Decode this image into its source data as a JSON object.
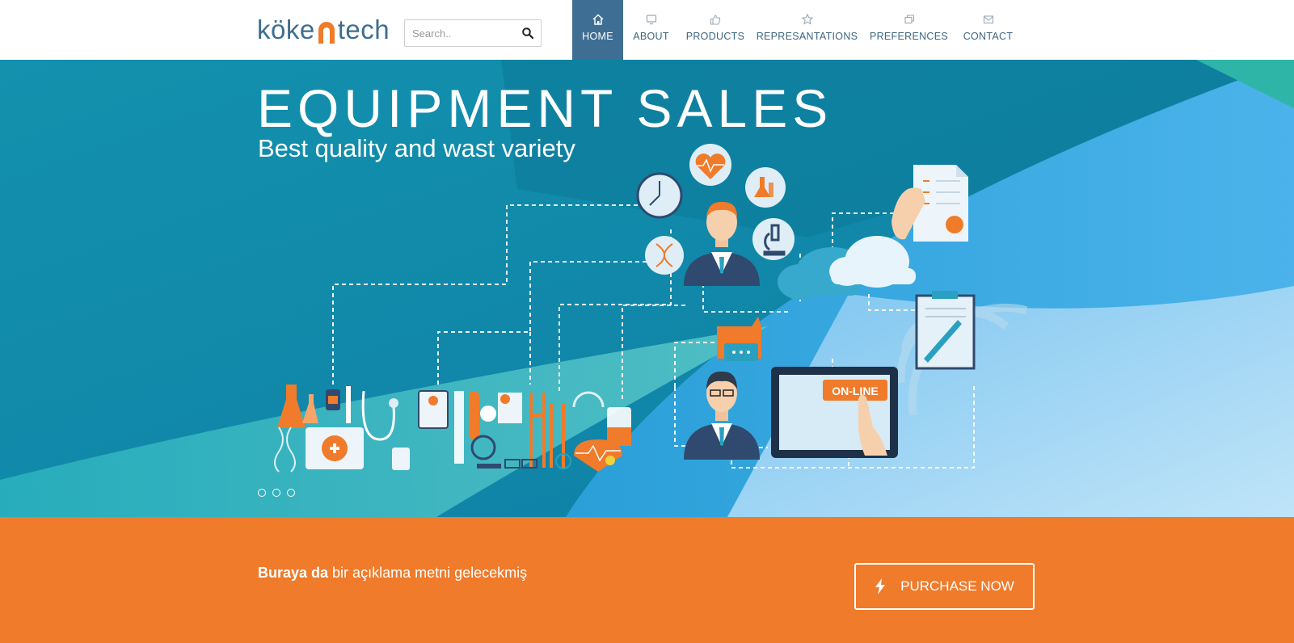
{
  "brand": {
    "logo_text_left": "köke",
    "logo_text_right": "tech",
    "colors": {
      "primary": "#3f6e8f",
      "accent": "#ef7b2b",
      "nav_active": "#3f6e94"
    }
  },
  "search": {
    "placeholder": "Search..",
    "icon": "search-icon"
  },
  "nav": {
    "items": [
      {
        "label": "HOME",
        "icon": "home-icon",
        "active": true
      },
      {
        "label": "ABOUT",
        "icon": "monitor-icon",
        "active": false
      },
      {
        "label": "PRODUCTS",
        "icon": "thumbs-up-icon",
        "active": false
      },
      {
        "label": "REPRESANTATIONS",
        "icon": "star-icon",
        "active": false
      },
      {
        "label": "PREFERENCES",
        "icon": "windows-icon",
        "active": false
      },
      {
        "label": "CONTACT",
        "icon": "envelope-icon",
        "active": false
      }
    ]
  },
  "hero": {
    "title": "EQUIPMENT SALES",
    "subtitle": "Best quality and wast variety",
    "badge": "ON-LINE",
    "slide_count": 3
  },
  "cta": {
    "text_bold": "Buraya da",
    "text_rest": " bir açıklama metni gelecekmiş",
    "button_label": "PURCHASE NOW",
    "button_icon": "lightning-icon"
  }
}
